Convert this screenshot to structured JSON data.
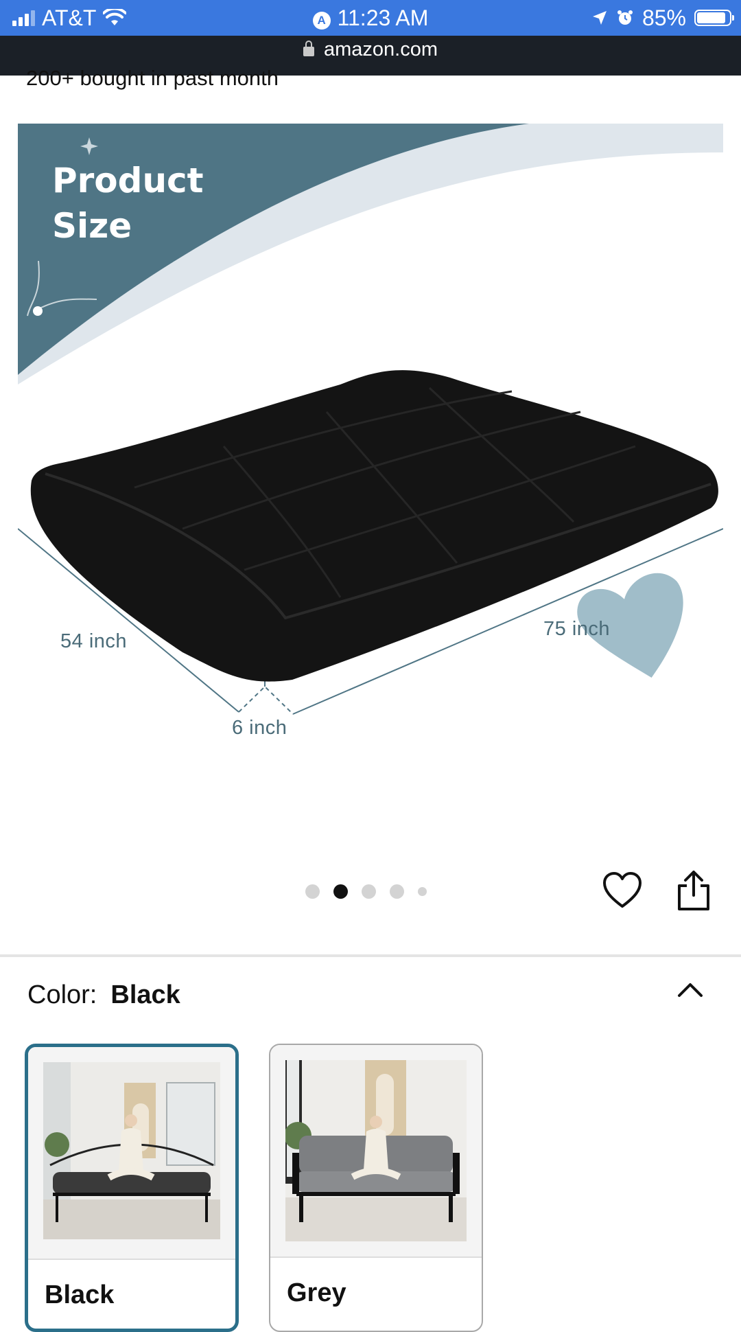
{
  "status_bar": {
    "carrier": "AT&T",
    "time": "11:23 AM",
    "battery": "85%"
  },
  "url_bar": {
    "domain": "amazon.com"
  },
  "product": {
    "bought_text": "200+ bought in past month",
    "image": {
      "title_line1": "Product",
      "title_line2": "Size",
      "width_label": "54 inch",
      "length_label": "75 inch",
      "height_label": "6 inch"
    },
    "carousel": {
      "total_dots": 5,
      "active_index": 1
    }
  },
  "color_selector": {
    "label": "Color:",
    "selected": "Black",
    "options": [
      {
        "name": "Black",
        "selected": true
      },
      {
        "name": "Grey",
        "selected": false
      }
    ]
  },
  "colors": {
    "status_bar": "#3a78df",
    "url_bar": "#1b2027",
    "accent_teal": "#2b6f8a",
    "banner_teal": "#4f7585"
  }
}
